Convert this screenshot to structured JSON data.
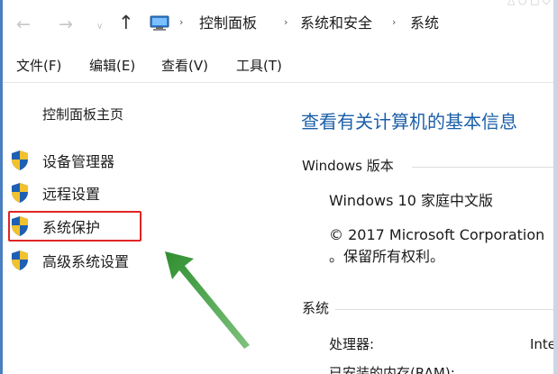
{
  "addressbar": {
    "breadcrumbs": [
      "控制面板",
      "系统和安全",
      "系统"
    ],
    "top_faint_text": "△ ○ □ ◇"
  },
  "menubar": {
    "items": [
      "文件(F)",
      "编辑(E)",
      "查看(V)",
      "工具(T)"
    ]
  },
  "left_pane": {
    "home_link": "控制面板主页",
    "tasks": [
      {
        "label": "设备管理器",
        "icon": "uac-shield-icon"
      },
      {
        "label": "远程设置",
        "icon": "uac-shield-icon"
      },
      {
        "label": "系统保护",
        "icon": "uac-shield-icon",
        "highlighted": true
      },
      {
        "label": "高级系统设置",
        "icon": "uac-shield-icon"
      }
    ]
  },
  "main": {
    "title": "查看有关计算机的基本信息",
    "windows_section": {
      "heading": "Windows 版本",
      "edition": "Windows 10 家庭中文版",
      "copyright_line1": "© 2017 Microsoft Corporation",
      "copyright_line2": "。保留所有权利。"
    },
    "system_section": {
      "heading": "系统",
      "processor_label": "处理器:",
      "processor_value": "Intel",
      "memory_label": "已安装的内存(RAM):"
    }
  },
  "colors": {
    "accent_title": "#1b5fa8",
    "highlight_box": "#e02424",
    "annotation_arrow": "#3a9a3a",
    "shield_blue": "#1e5fb3",
    "shield_yellow": "#f2c12e"
  }
}
